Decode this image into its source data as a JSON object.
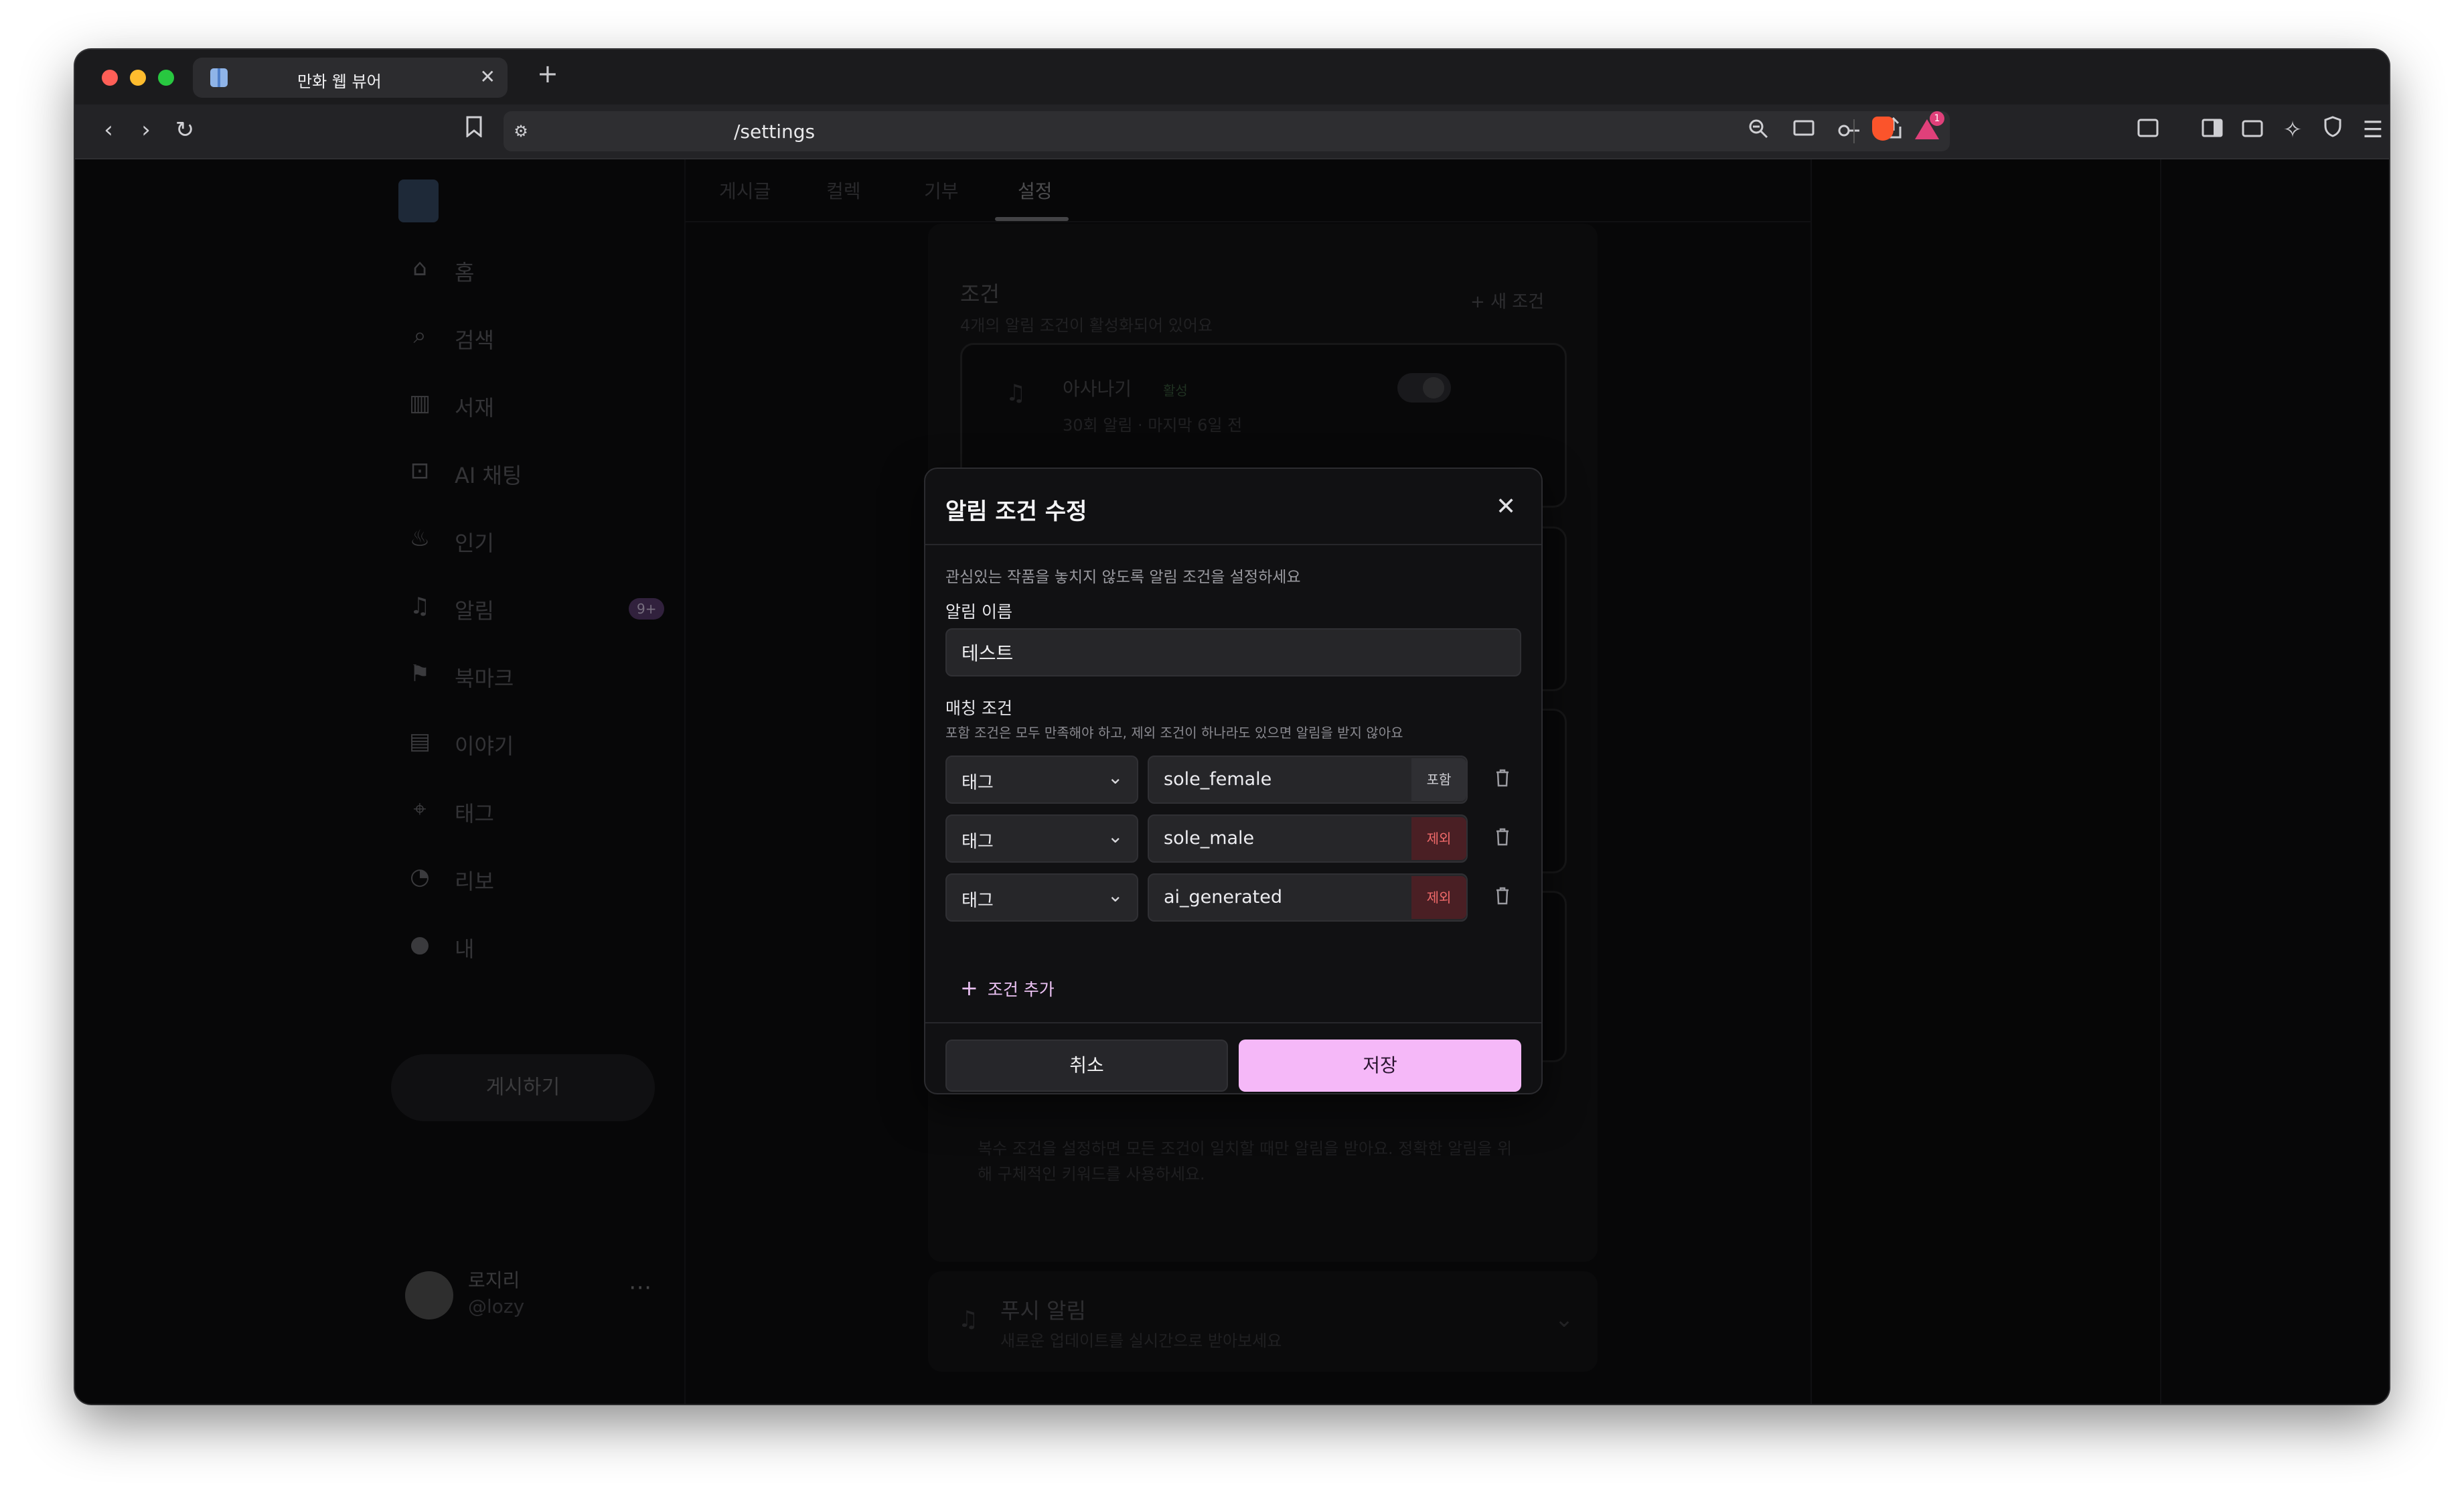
{
  "browser": {
    "tab_title": "만화 웹 뷰어",
    "tab_close": "✕",
    "new_tab": "+",
    "url": "/settings",
    "rewards_count": "1"
  },
  "sidebar": {
    "items": [
      {
        "label": "홈",
        "icon": "home-icon"
      },
      {
        "label": "검색",
        "icon": "search-icon"
      },
      {
        "label": "서재",
        "icon": "library-icon"
      },
      {
        "label": "AI 채팅",
        "icon": "robot-icon"
      },
      {
        "label": "인기",
        "icon": "flame-icon"
      },
      {
        "label": "알림",
        "icon": "bell-icon",
        "badge": "9+"
      },
      {
        "label": "북마크",
        "icon": "bookmark-icon"
      },
      {
        "label": "이야기",
        "icon": "document-icon"
      },
      {
        "label": "태그",
        "icon": "tag-icon"
      },
      {
        "label": "리보",
        "icon": "piggy-bank-icon"
      },
      {
        "label": "내",
        "icon": "user-icon"
      }
    ],
    "post_button": "게시하기",
    "user": {
      "name": "로지리",
      "handle": "@lozy"
    }
  },
  "page_tabs": [
    "게시글",
    "컬렉",
    "기부",
    "설정"
  ],
  "conditions_section": {
    "title": "조건",
    "subtitle": "4개의 알림 조건이 활성화되어 있어요",
    "new_button": "새 조건",
    "first_card": {
      "name": "아사나기",
      "status": "활성",
      "meta": "30회 알림 · 마지막 6일 전"
    },
    "info_note": "복수 조건을 설정하면 모든 조건이 일치할 때만 알림을 받아요. 정확한 알림을 위해 구체적인 키워드를 사용하세요."
  },
  "push_section": {
    "title": "푸시 알림",
    "subtitle": "새로운 업데이트를 실시간으로 받아보세요"
  },
  "modal": {
    "title": "알림 조건 수정",
    "description": "관심있는 작품을 놓치지 않도록 알림 조건을 설정하세요",
    "name_label": "알림 이름",
    "name_value": "테스트",
    "match_label": "매칭 조건",
    "match_help": "포함 조건은 모두 만족해야 하고, 제외 조건이 하나라도 있으면 알림을 받지 않아요",
    "rows": [
      {
        "type": "태그",
        "value": "sole_female",
        "mode": "포함",
        "mode_kind": "include"
      },
      {
        "type": "태그",
        "value": "sole_male",
        "mode": "제외",
        "mode_kind": "exclude"
      },
      {
        "type": "태그",
        "value": "ai_generated",
        "mode": "제외",
        "mode_kind": "exclude"
      }
    ],
    "add_condition": "조건 추가",
    "cancel": "취소",
    "save": "저장"
  },
  "colors": {
    "accent": "#f5b8f8",
    "exclude": "#f06a6a",
    "modal_bg": "#111113"
  }
}
